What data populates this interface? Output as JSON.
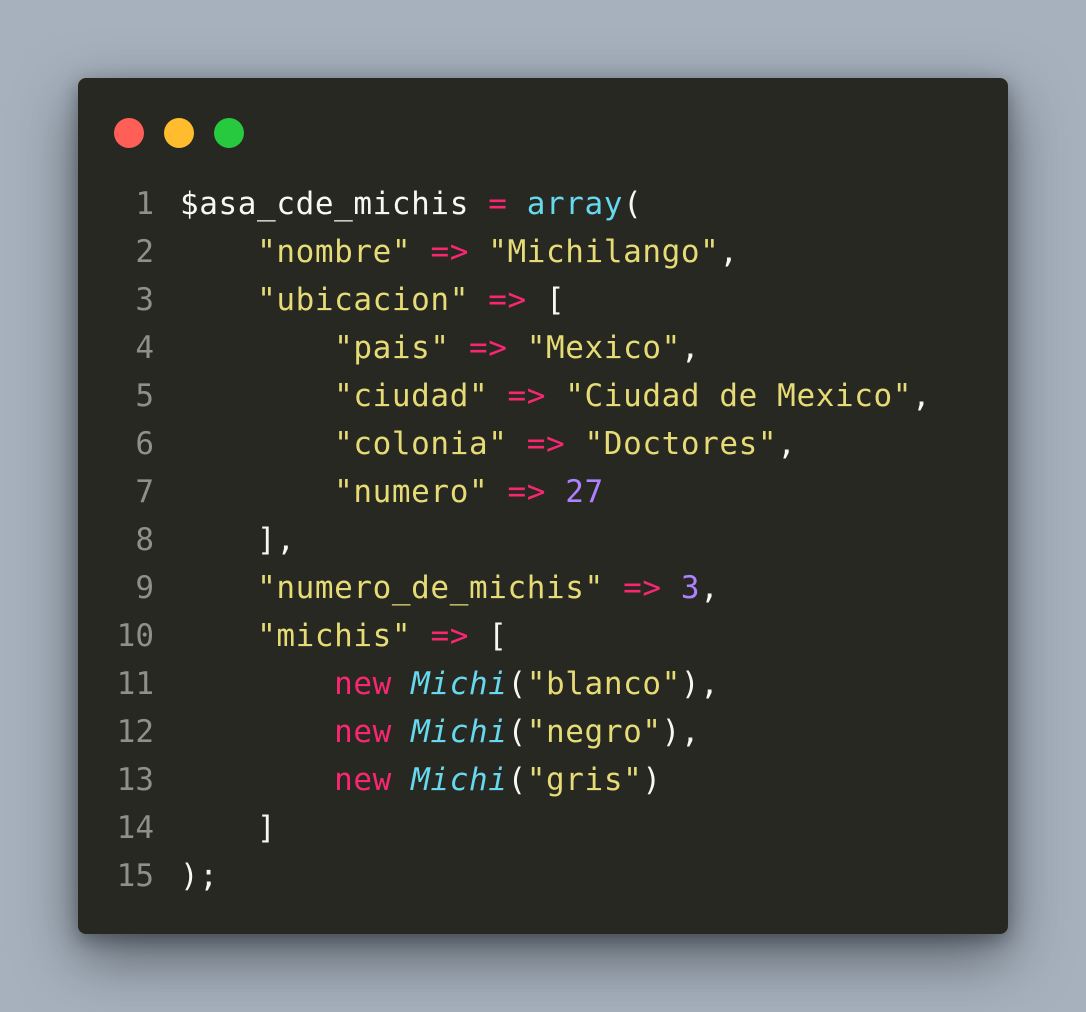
{
  "window": {
    "traffic_lights": [
      {
        "name": "close",
        "color": "#ff5f56"
      },
      {
        "name": "minimize",
        "color": "#ffbd2e"
      },
      {
        "name": "maximize",
        "color": "#27c93f"
      }
    ]
  },
  "code": {
    "theme": {
      "background": "#272822",
      "plain": "#f8f8f2",
      "operator": "#f92672",
      "keyword": "#f92672",
      "function": "#66d9ef",
      "string": "#e6db74",
      "number": "#ae81ff",
      "line_number": "#8f908a"
    },
    "lines": [
      {
        "number": "1",
        "tokens": [
          {
            "t": "$asa_cde_michis ",
            "k": "plain"
          },
          {
            "t": "=",
            "k": "op"
          },
          {
            "t": " ",
            "k": "plain"
          },
          {
            "t": "array",
            "k": "fn"
          },
          {
            "t": "(",
            "k": "plain"
          }
        ]
      },
      {
        "number": "2",
        "tokens": [
          {
            "t": "    ",
            "k": "plain"
          },
          {
            "t": "\"nombre\"",
            "k": "str"
          },
          {
            "t": " ",
            "k": "plain"
          },
          {
            "t": "=>",
            "k": "op"
          },
          {
            "t": " ",
            "k": "plain"
          },
          {
            "t": "\"Michilango\"",
            "k": "str"
          },
          {
            "t": ",",
            "k": "plain"
          }
        ]
      },
      {
        "number": "3",
        "tokens": [
          {
            "t": "    ",
            "k": "plain"
          },
          {
            "t": "\"ubicacion\"",
            "k": "str"
          },
          {
            "t": " ",
            "k": "plain"
          },
          {
            "t": "=>",
            "k": "op"
          },
          {
            "t": " [",
            "k": "plain"
          }
        ]
      },
      {
        "number": "4",
        "tokens": [
          {
            "t": "        ",
            "k": "plain"
          },
          {
            "t": "\"pais\"",
            "k": "str"
          },
          {
            "t": " ",
            "k": "plain"
          },
          {
            "t": "=>",
            "k": "op"
          },
          {
            "t": " ",
            "k": "plain"
          },
          {
            "t": "\"Mexico\"",
            "k": "str"
          },
          {
            "t": ",",
            "k": "plain"
          }
        ]
      },
      {
        "number": "5",
        "tokens": [
          {
            "t": "        ",
            "k": "plain"
          },
          {
            "t": "\"ciudad\"",
            "k": "str"
          },
          {
            "t": " ",
            "k": "plain"
          },
          {
            "t": "=>",
            "k": "op"
          },
          {
            "t": " ",
            "k": "plain"
          },
          {
            "t": "\"Ciudad de Mexico\"",
            "k": "str"
          },
          {
            "t": ",",
            "k": "plain"
          }
        ]
      },
      {
        "number": "6",
        "tokens": [
          {
            "t": "        ",
            "k": "plain"
          },
          {
            "t": "\"colonia\"",
            "k": "str"
          },
          {
            "t": " ",
            "k": "plain"
          },
          {
            "t": "=>",
            "k": "op"
          },
          {
            "t": " ",
            "k": "plain"
          },
          {
            "t": "\"Doctores\"",
            "k": "str"
          },
          {
            "t": ",",
            "k": "plain"
          }
        ]
      },
      {
        "number": "7",
        "tokens": [
          {
            "t": "        ",
            "k": "plain"
          },
          {
            "t": "\"numero\"",
            "k": "str"
          },
          {
            "t": " ",
            "k": "plain"
          },
          {
            "t": "=>",
            "k": "op"
          },
          {
            "t": " ",
            "k": "plain"
          },
          {
            "t": "27",
            "k": "num"
          }
        ]
      },
      {
        "number": "8",
        "tokens": [
          {
            "t": "    ],",
            "k": "plain"
          }
        ]
      },
      {
        "number": "9",
        "tokens": [
          {
            "t": "    ",
            "k": "plain"
          },
          {
            "t": "\"numero_de_michis\"",
            "k": "str"
          },
          {
            "t": " ",
            "k": "plain"
          },
          {
            "t": "=>",
            "k": "op"
          },
          {
            "t": " ",
            "k": "plain"
          },
          {
            "t": "3",
            "k": "num"
          },
          {
            "t": ",",
            "k": "plain"
          }
        ]
      },
      {
        "number": "10",
        "tokens": [
          {
            "t": "    ",
            "k": "plain"
          },
          {
            "t": "\"michis\"",
            "k": "str"
          },
          {
            "t": " ",
            "k": "plain"
          },
          {
            "t": "=>",
            "k": "op"
          },
          {
            "t": " [",
            "k": "plain"
          }
        ]
      },
      {
        "number": "11",
        "tokens": [
          {
            "t": "        ",
            "k": "plain"
          },
          {
            "t": "new",
            "k": "kw"
          },
          {
            "t": " ",
            "k": "plain"
          },
          {
            "t": "Michi",
            "k": "cls"
          },
          {
            "t": "(",
            "k": "plain"
          },
          {
            "t": "\"blanco\"",
            "k": "str"
          },
          {
            "t": "),",
            "k": "plain"
          }
        ]
      },
      {
        "number": "12",
        "tokens": [
          {
            "t": "        ",
            "k": "plain"
          },
          {
            "t": "new",
            "k": "kw"
          },
          {
            "t": " ",
            "k": "plain"
          },
          {
            "t": "Michi",
            "k": "cls"
          },
          {
            "t": "(",
            "k": "plain"
          },
          {
            "t": "\"negro\"",
            "k": "str"
          },
          {
            "t": "),",
            "k": "plain"
          }
        ]
      },
      {
        "number": "13",
        "tokens": [
          {
            "t": "        ",
            "k": "plain"
          },
          {
            "t": "new",
            "k": "kw"
          },
          {
            "t": " ",
            "k": "plain"
          },
          {
            "t": "Michi",
            "k": "cls"
          },
          {
            "t": "(",
            "k": "plain"
          },
          {
            "t": "\"gris\"",
            "k": "str"
          },
          {
            "t": ")",
            "k": "plain"
          }
        ]
      },
      {
        "number": "14",
        "tokens": [
          {
            "t": "    ]",
            "k": "plain"
          }
        ]
      },
      {
        "number": "15",
        "tokens": [
          {
            "t": ");",
            "k": "plain"
          }
        ]
      }
    ]
  }
}
